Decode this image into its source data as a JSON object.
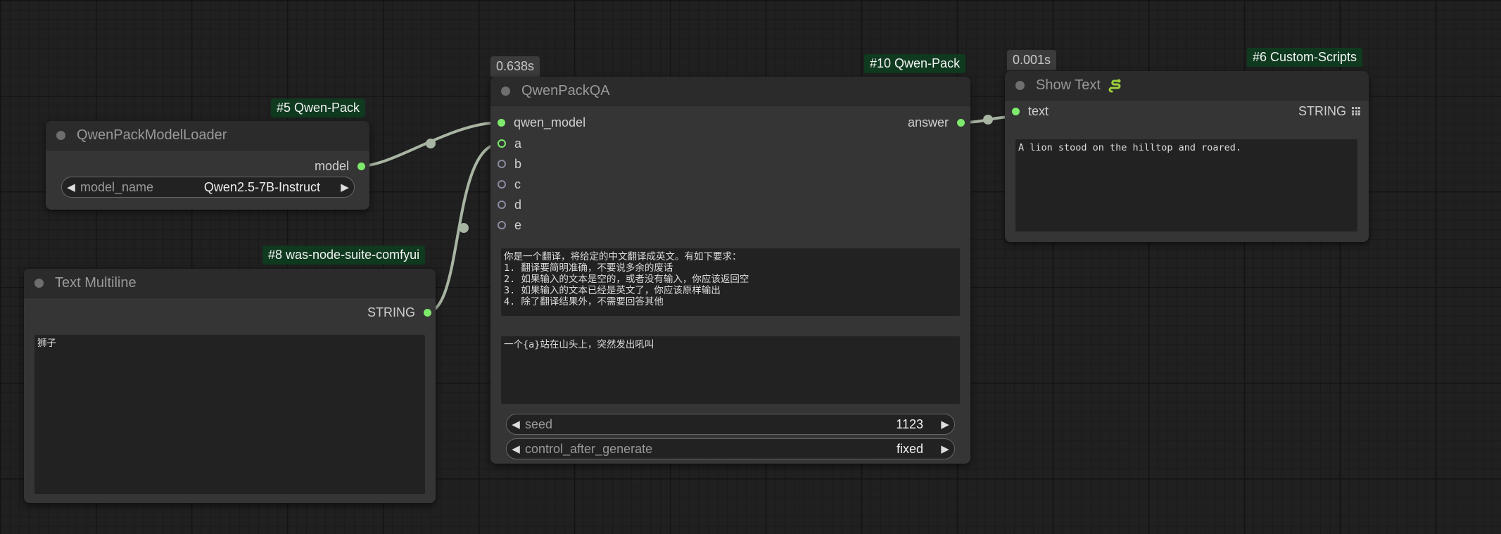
{
  "nodes": {
    "loader": {
      "badge": "#5 Qwen-Pack",
      "title": "QwenPackModelLoader",
      "output_label": "model",
      "widget": {
        "label": "model_name",
        "value": "Qwen2.5-7B-Instruct"
      }
    },
    "multiline": {
      "badge": "#8 was-node-suite-comfyui",
      "title": "Text Multiline",
      "output_label": "STRING",
      "text": "狮子"
    },
    "qa": {
      "timer": "0.638s",
      "badge": "#10 Qwen-Pack",
      "title": "QwenPackQA",
      "inputs": [
        "qwen_model",
        "a",
        "b",
        "c",
        "d",
        "e"
      ],
      "output_label": "answer",
      "system_prompt": "你是一个翻译，将给定的中文翻译成英文。有如下要求：\n1. 翻译要简明准确，不要说多余的废话\n2. 如果输入的文本是空的，或者没有输入，你应该返回空\n3. 如果输入的文本已经是英文了，你应该原样输出\n4. 除了翻译结果外，不需要回答其他",
      "user_prompt": "一个{a}站在山头上，突然发出吼叫",
      "seed": {
        "label": "seed",
        "value": "1123"
      },
      "control": {
        "label": "control_after_generate",
        "value": "fixed"
      }
    },
    "show": {
      "timer": "0.001s",
      "badge": "#6 Custom-Scripts",
      "title": "Show Text",
      "icon": "snake-icon",
      "input_label": "text",
      "input_type": "STRING",
      "text": "A lion stood on the hilltop and roared."
    }
  },
  "colors": {
    "link": "#a9b5a3",
    "slot_connected": "#7eea6c",
    "badge_bg": "#0f3a1f"
  }
}
